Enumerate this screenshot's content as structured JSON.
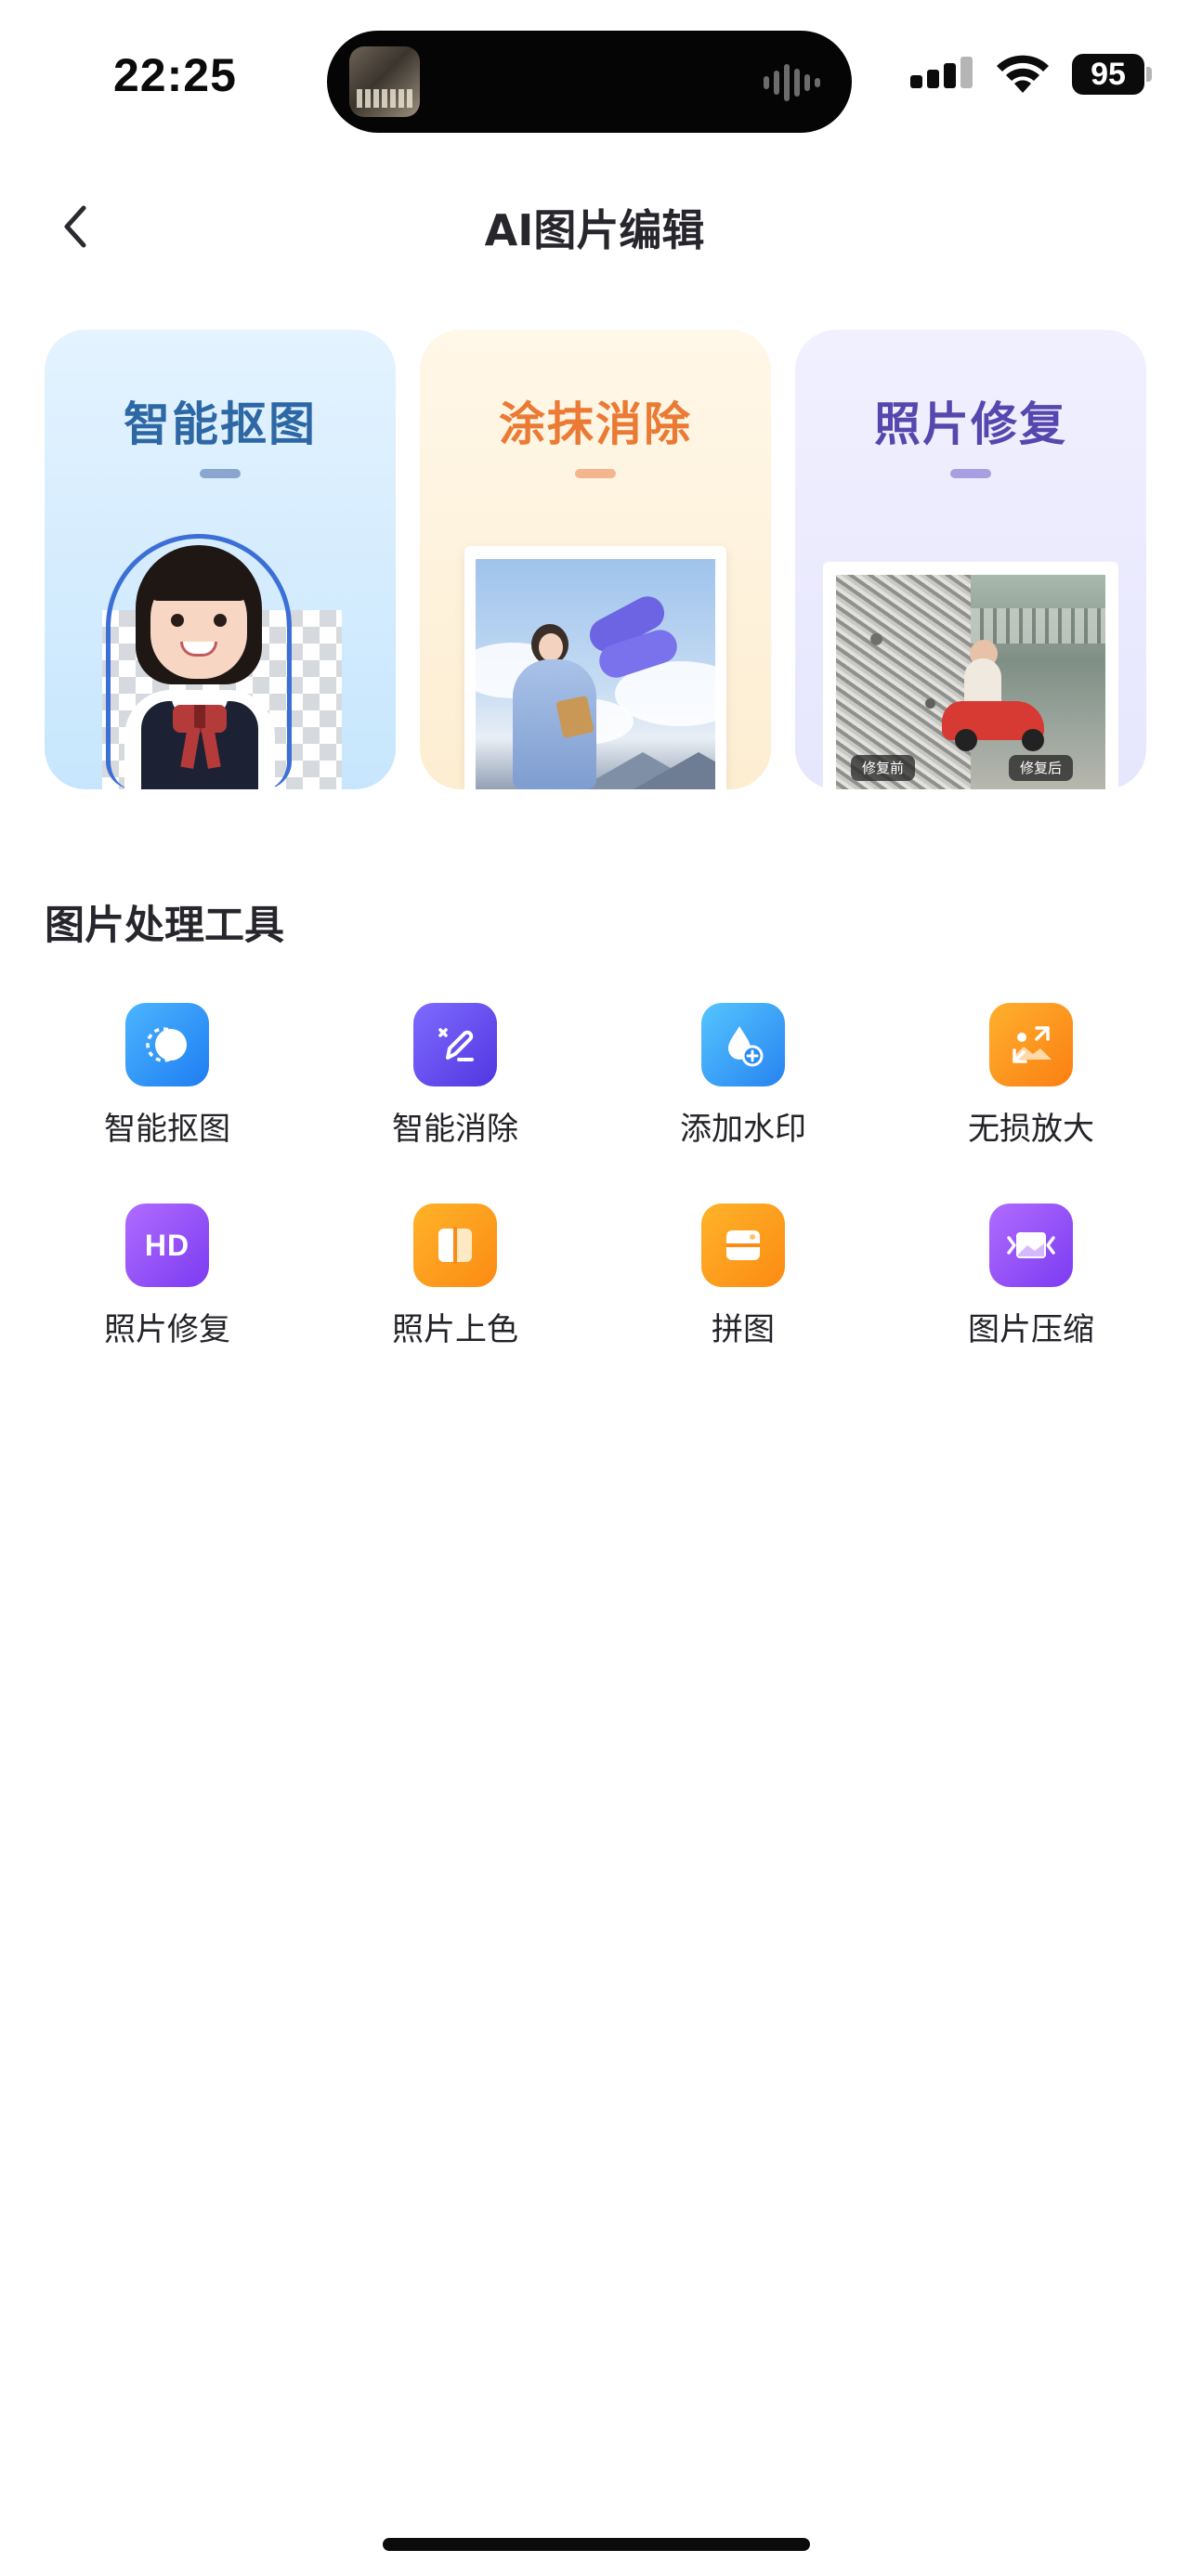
{
  "status_bar": {
    "time": "22:25",
    "battery": "95"
  },
  "header": {
    "title": "AI图片编辑",
    "back_icon": "chevron-left-icon"
  },
  "feature_cards": [
    {
      "title": "智能抠图",
      "color": "#2d67a4"
    },
    {
      "title": "涂抹消除",
      "color": "#ea7a34"
    },
    {
      "title": "照片修复",
      "color": "#5646ad",
      "before_tag": "修复前",
      "after_tag": "修复后"
    }
  ],
  "tools": {
    "section_title": "图片处理工具",
    "items": [
      {
        "label": "智能抠图",
        "icon": "cutout-icon"
      },
      {
        "label": "智能消除",
        "icon": "eraser-pen-icon"
      },
      {
        "label": "添加水印",
        "icon": "watermark-drop-icon"
      },
      {
        "label": "无损放大",
        "icon": "enlarge-image-icon"
      },
      {
        "label": "照片修复",
        "icon": "hd-icon"
      },
      {
        "label": "照片上色",
        "icon": "colorize-icon"
      },
      {
        "label": "拼图",
        "icon": "collage-icon"
      },
      {
        "label": "图片压缩",
        "icon": "compress-image-icon"
      }
    ]
  }
}
